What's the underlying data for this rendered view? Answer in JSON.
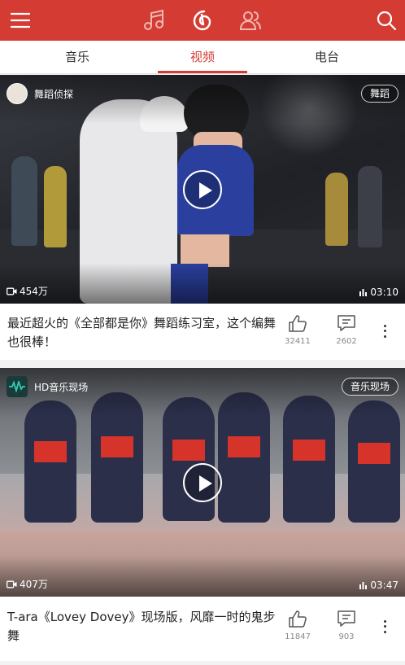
{
  "colors": {
    "brand": "#d43c33",
    "tab_active": "#d43c33"
  },
  "header": {
    "icons": [
      "menu-icon",
      "music-note-icon",
      "netease-cloud-icon",
      "friends-icon",
      "search-icon"
    ]
  },
  "tabs": [
    {
      "label": "音乐",
      "active": false
    },
    {
      "label": "视频",
      "active": true
    },
    {
      "label": "电台",
      "active": false
    }
  ],
  "videos": [
    {
      "uploader": "舞蹈侦探",
      "tag": "舞蹈",
      "views": "454万",
      "duration": "03:10",
      "title": "最近超火的《全部都是你》舞蹈练习室，这个编舞也很棒！",
      "likes": "32411",
      "comments": "2602"
    },
    {
      "uploader": "HD音乐现场",
      "tag": "音乐现场",
      "views": "407万",
      "duration": "03:47",
      "title": "T-ara《Lovey Dovey》现场版，风靡一时的鬼步舞",
      "likes": "11847",
      "comments": "903"
    }
  ]
}
